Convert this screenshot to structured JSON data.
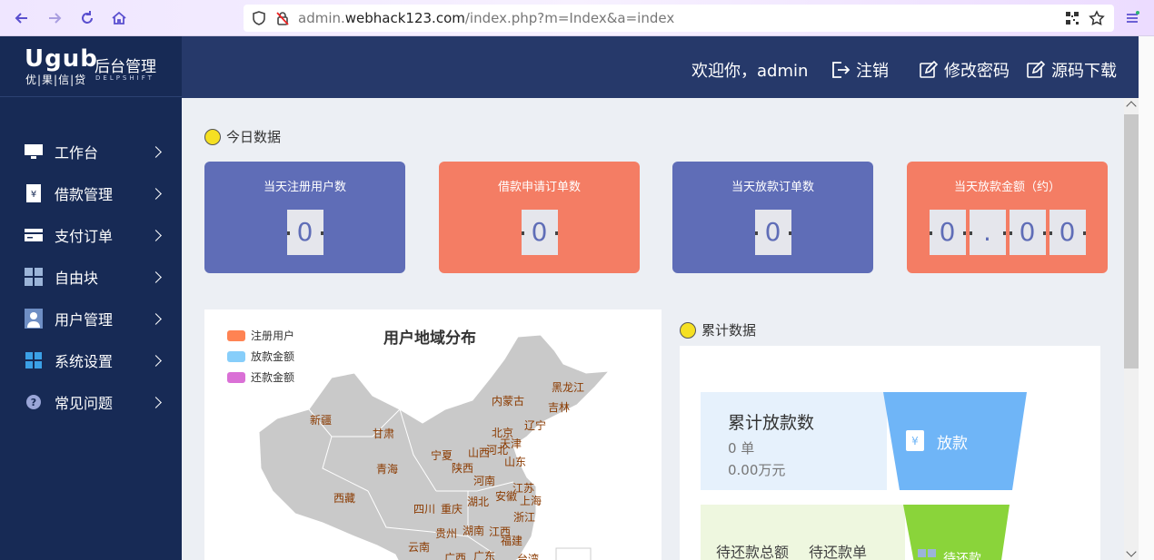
{
  "browser": {
    "url_prefix": "admin.",
    "url_domain": "webhack123.com",
    "url_path": "/index.php?m=Index&a=index"
  },
  "brand": {
    "logo_mark": "Ugub",
    "logo_sub": "优|果|信|贷",
    "title": "后台管理",
    "subtitle": "DELPSHIFT"
  },
  "sidebar": {
    "items": [
      {
        "label": "工作台",
        "icon": "monitor-icon"
      },
      {
        "label": "借款管理",
        "icon": "money-book-icon"
      },
      {
        "label": "支付订单",
        "icon": "card-icon"
      },
      {
        "label": "自由块",
        "icon": "grid-icon"
      },
      {
        "label": "用户管理",
        "icon": "user-icon"
      },
      {
        "label": "系统设置",
        "icon": "windows-icon"
      },
      {
        "label": "常见问题",
        "icon": "question-icon"
      }
    ]
  },
  "header": {
    "welcome": "欢迎你，admin",
    "logout": "注销",
    "change_password": "修改密码",
    "download_source": "源码下载"
  },
  "today": {
    "section_title": "今日数据",
    "cards": [
      {
        "title": "当天注册用户数",
        "digits": [
          "0"
        ],
        "color": "#5f6db7"
      },
      {
        "title": "借款申请订单数",
        "digits": [
          "0"
        ],
        "color": "#f47d64"
      },
      {
        "title": "当天放款订单数",
        "digits": [
          "0"
        ],
        "color": "#5f6db7"
      },
      {
        "title": "当天放款金额（约）",
        "digits": [
          "0",
          ".",
          "0",
          "0"
        ],
        "color": "#f47d64"
      }
    ]
  },
  "map": {
    "title": "用户地域分布",
    "legend": [
      {
        "label": "注册用户",
        "color": "#ff8353"
      },
      {
        "label": "放款金额",
        "color": "#87cefa"
      },
      {
        "label": "还款金额",
        "color": "#da70d6"
      }
    ],
    "provinces": [
      "黑龙江",
      "吉林",
      "内蒙古",
      "辽宁",
      "新疆",
      "甘肃",
      "北京",
      "天津",
      "宁夏",
      "山西",
      "河北",
      "山东",
      "青海",
      "陕西",
      "河南",
      "江苏",
      "西藏",
      "安徽",
      "上海",
      "四川",
      "重庆",
      "湖北",
      "浙江",
      "贵州",
      "湖南",
      "江西",
      "福建",
      "云南",
      "广西",
      "广东",
      "台湾"
    ]
  },
  "cumulative": {
    "section_title": "累计数据",
    "loan_count_label": "累计放款数",
    "loan_count_value": "0 单",
    "loan_amount_value": "0.00万元",
    "loan_tag": "放款",
    "repay_total_label": "待还款总额",
    "repay_orders_label": "待还款单",
    "repay_tag": "待还款"
  }
}
